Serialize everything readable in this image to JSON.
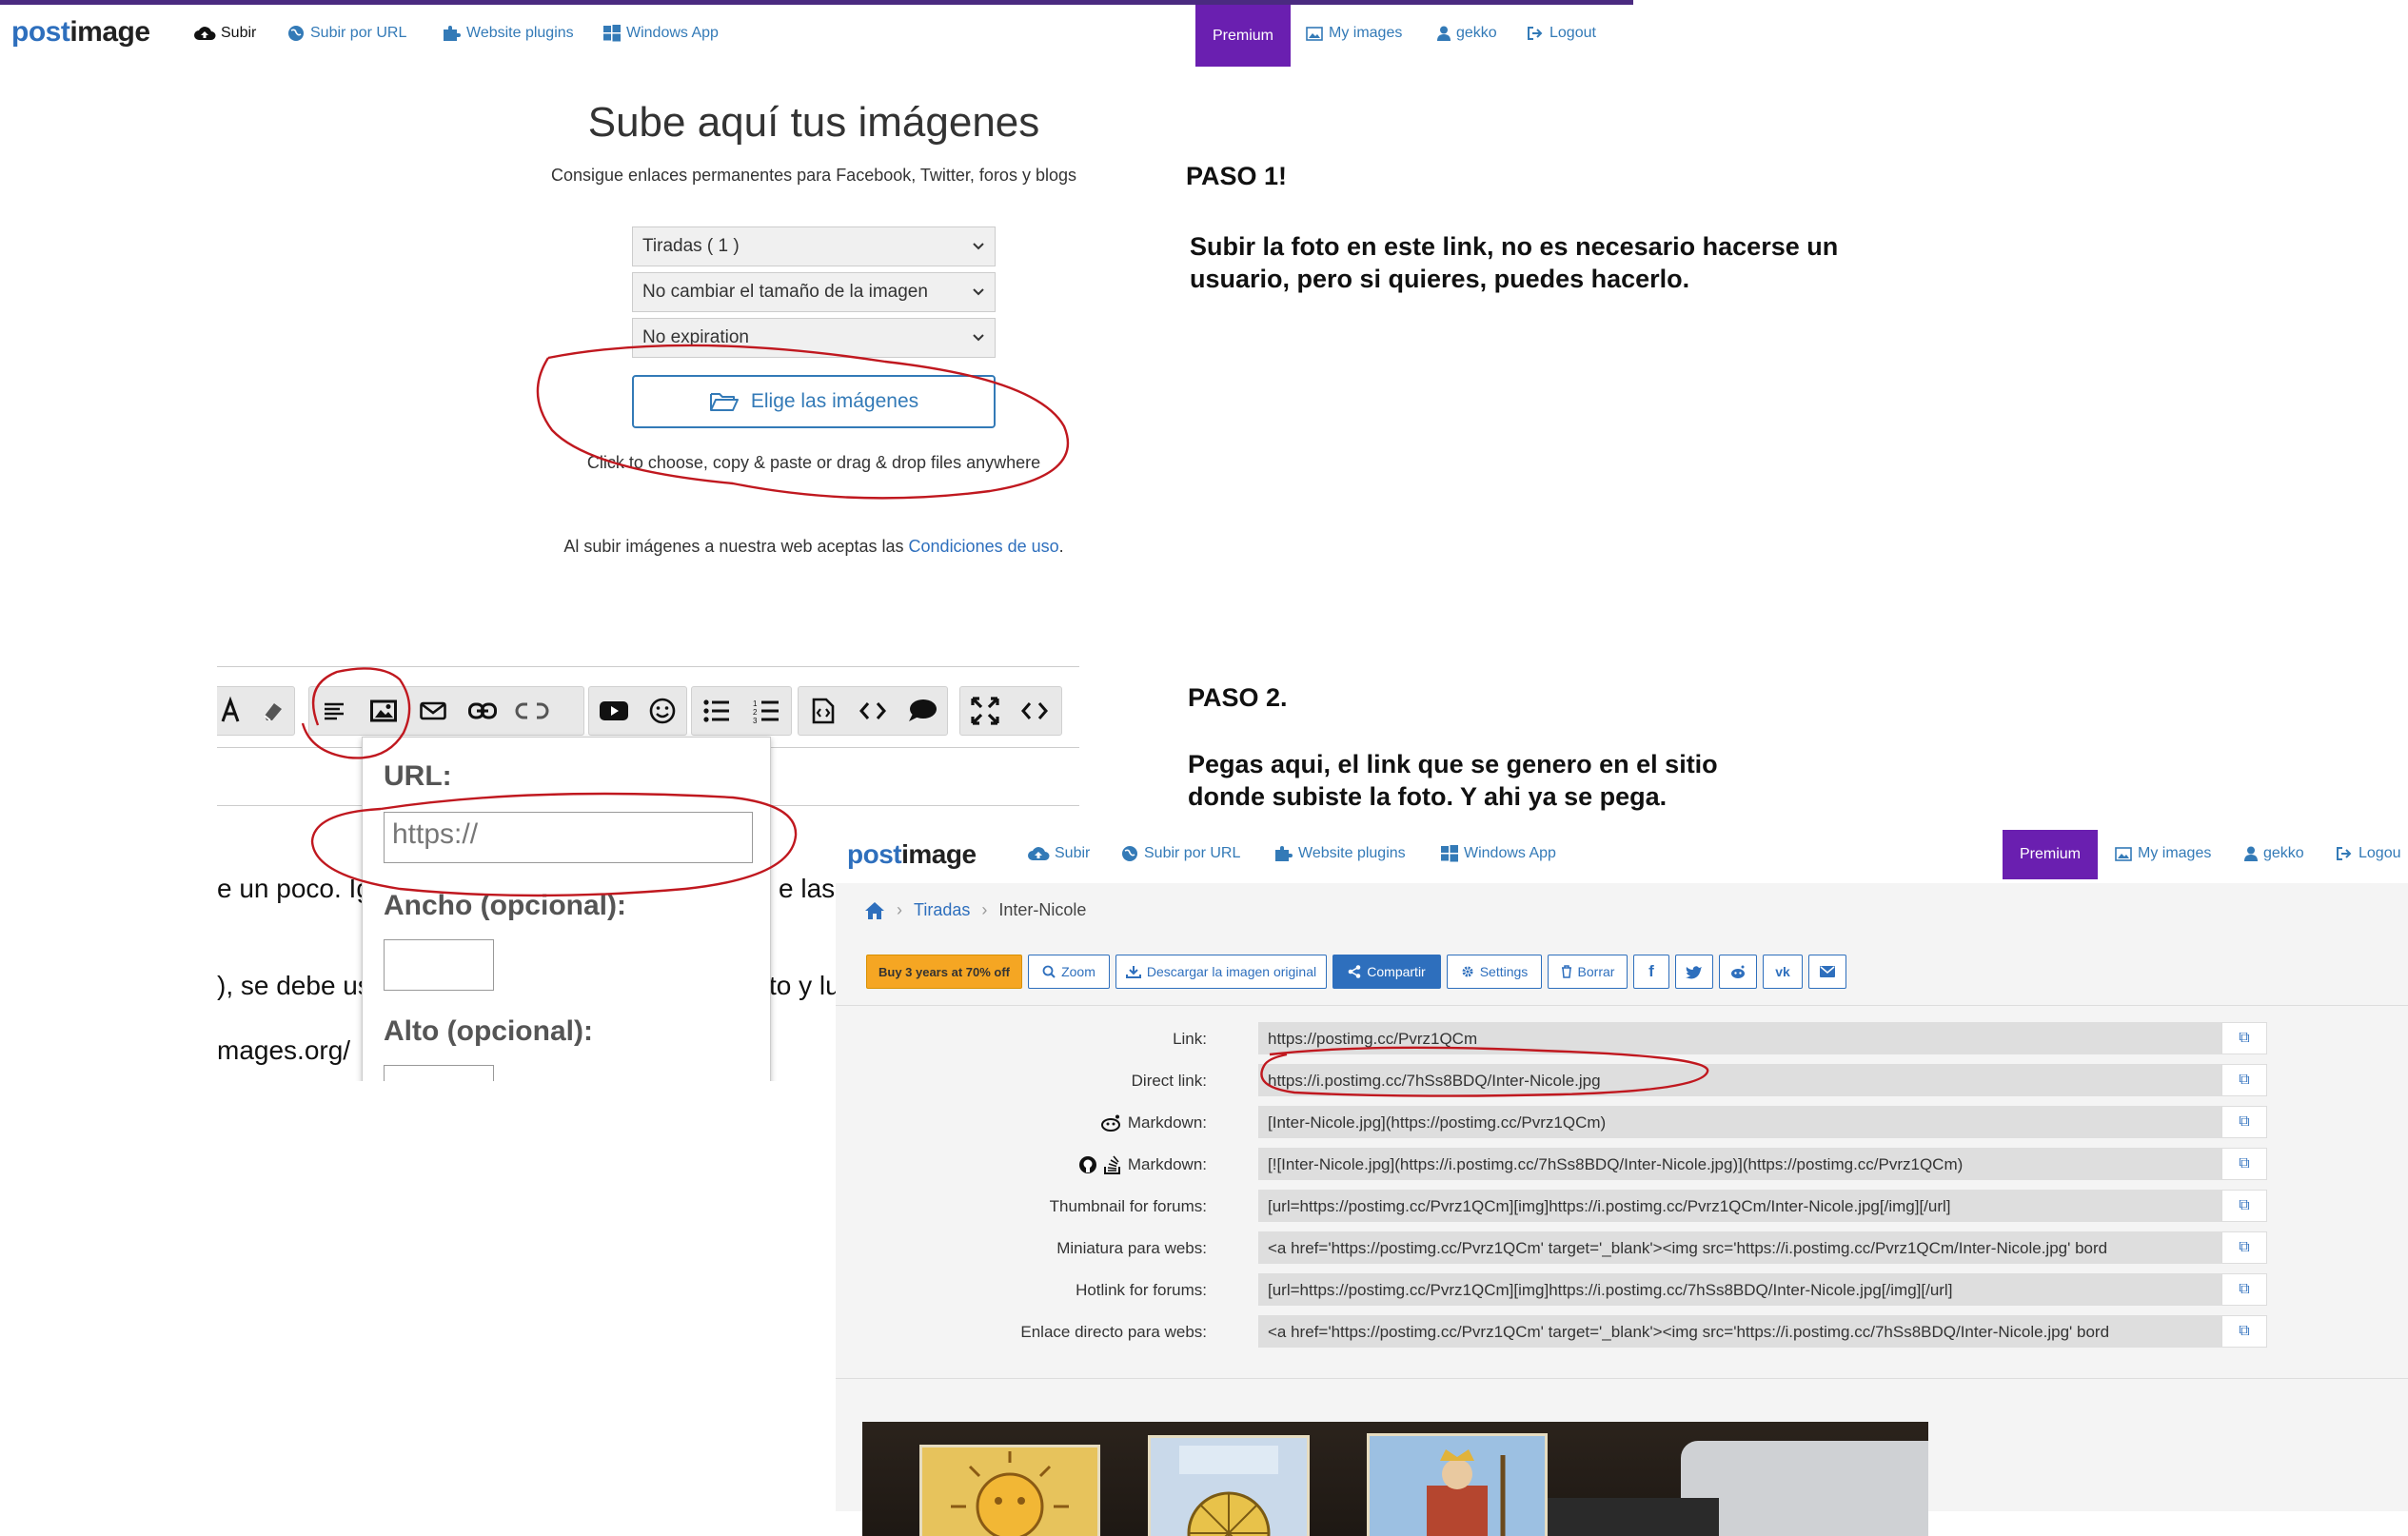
{
  "nav1": {
    "logo_a": "post",
    "logo_b": "image",
    "subir": "Subir",
    "subir_url": "Subir por URL",
    "plugins": "Website plugins",
    "windows": "Windows App",
    "premium": "Premium",
    "my_images": "My images",
    "user": "gekko",
    "logout": "Logout"
  },
  "upload": {
    "title": "Sube aquí tus imágenes",
    "subtitle": "Consigue enlaces permanentes para Facebook, Twitter, foros y blogs",
    "select_gallery": "Tiradas ( 1 )",
    "select_resize": "No cambiar el tamaño de la imagen",
    "select_expiration": "No expiration",
    "choose_button": "Elige las imágenes",
    "hint": "Click to choose, copy & paste or drag & drop files anywhere",
    "terms_prefix": "Al subir imágenes a nuestra web aceptas las ",
    "terms_link": "Condiciones de uso",
    "terms_suffix": "."
  },
  "step1": {
    "heading": "PASO 1!",
    "line1": "Subir la foto en este link, no es necesario hacerse un",
    "line2": "usuario, pero si quieres, puedes hacerlo."
  },
  "step2": {
    "heading": "PASO 2.",
    "line1": "Pegas aqui, el link que se genero en el sitio",
    "line2": "donde subiste la foto. Y ahi ya se pega."
  },
  "editor": {
    "text1a": "e un poco. Ig",
    "text1b": "e las p",
    "text2a": "), se debe us",
    "text2b": "to y lu",
    "text3": "mages.org/",
    "popup_url_label": "URL:",
    "popup_url_placeholder": "https://",
    "popup_width_label": "Ancho (opcional):",
    "popup_height_label": "Alto (opcional):"
  },
  "nav3": {
    "logo_a": "post",
    "logo_b": "image",
    "subir": "Subir",
    "subir_url": "Subir por URL",
    "plugins": "Website plugins",
    "windows": "Windows App",
    "premium": "Premium",
    "my_images": "My images",
    "user": "gekko",
    "logout": "Logou"
  },
  "result": {
    "crumb_gallery": "Tiradas",
    "crumb_image": "Inter-Nicole",
    "btn_buy": "Buy 3 years at 70% off",
    "btn_zoom": "Zoom",
    "btn_download": "Descargar la imagen original",
    "btn_share": "Compartir",
    "btn_settings": "Settings",
    "btn_delete": "Borrar",
    "rows": [
      {
        "label": "Link:",
        "value": "https://postimg.cc/Pvrz1QCm"
      },
      {
        "label": "Direct link:",
        "value": "https://i.postimg.cc/7hSs8BDQ/Inter-Nicole.jpg"
      },
      {
        "label": "Markdown:",
        "value": "[Inter-Nicole.jpg](https://postimg.cc/Pvrz1QCm)"
      },
      {
        "label": "Markdown:",
        "value": "[![Inter-Nicole.jpg](https://i.postimg.cc/7hSs8BDQ/Inter-Nicole.jpg)](https://postimg.cc/Pvrz1QCm)"
      },
      {
        "label": "Thumbnail for forums:",
        "value": "[url=https://postimg.cc/Pvrz1QCm][img]https://i.postimg.cc/Pvrz1QCm/Inter-Nicole.jpg[/img][/url]"
      },
      {
        "label": "Miniatura para webs:",
        "value": "<a href='https://postimg.cc/Pvrz1QCm' target='_blank'><img src='https://i.postimg.cc/Pvrz1QCm/Inter-Nicole.jpg' bord"
      },
      {
        "label": "Hotlink for forums:",
        "value": "[url=https://postimg.cc/Pvrz1QCm][img]https://i.postimg.cc/7hSs8BDQ/Inter-Nicole.jpg[/img][/url]"
      },
      {
        "label": "Enlace directo para webs:",
        "value": "<a href='https://postimg.cc/Pvrz1QCm' target='_blank'><img src='https://i.postimg.cc/7hSs8BDQ/Inter-Nicole.jpg' bord"
      }
    ]
  },
  "colors": {
    "brand_blue": "#2e6fbd",
    "premium_purple": "#6a1fb0",
    "annotation_red": "#c0181f",
    "buy_yellow": "#f5a623"
  }
}
